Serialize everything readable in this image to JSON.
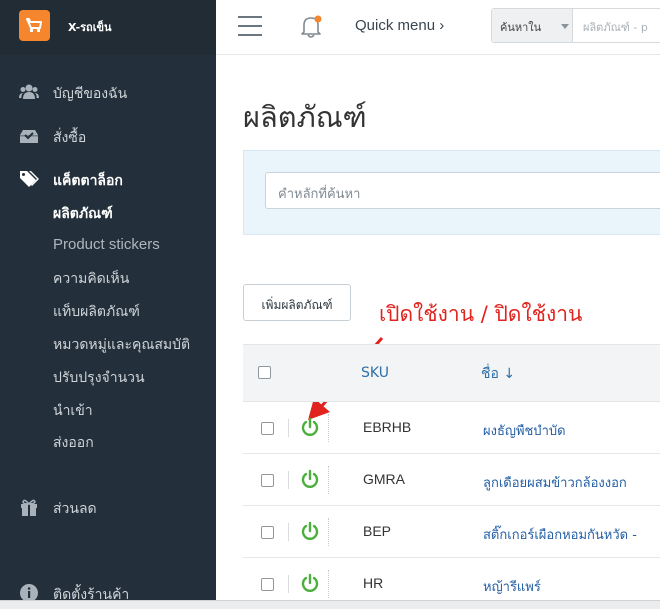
{
  "brand": {
    "name": "X-รถเข็น"
  },
  "sidebar": {
    "items": [
      {
        "label": "บัญชีของฉัน",
        "icon": "users-icon"
      },
      {
        "label": "สั่งซื้อ",
        "icon": "inbox-download-icon"
      },
      {
        "label": "แค็ตตาล็อก",
        "icon": "tags-icon"
      },
      {
        "label": "ส่วนลด",
        "icon": "gift-icon"
      },
      {
        "label": "ติดตั้งร้านค้า",
        "icon": "info-icon"
      }
    ],
    "catalog_sub": [
      "ผลิตภัณฑ์",
      "Product stickers",
      "ความคิดเห็น",
      "แท็บผลิตภัณฑ์",
      "หมวดหมู่และคุณสมบัติ",
      "ปรับปรุงจำนวน",
      "นำเข้า",
      "ส่งออก"
    ]
  },
  "topbar": {
    "quick_menu": "Quick menu ›",
    "search_scope": "ค้นหาใน",
    "search_placeholder": "ผลิตภัณฑ์ - p"
  },
  "main": {
    "title": "ผลิตภัณฑ์",
    "keyword_placeholder": "คำหลักที่ค้นหา",
    "add_button": "เพิ่มผลิตภัณฑ์",
    "annotation": "เปิดใช้งาน  / ปิดใช้งาน"
  },
  "table": {
    "columns": {
      "sku": "SKU",
      "name": "ชื่อ ↓"
    },
    "rows": [
      {
        "sku": "EBRHB",
        "name": "ผงธัญพืชบำบัด"
      },
      {
        "sku": "GMRA",
        "name": "ลูกเดือยผสมข้าวกล้องงอก"
      },
      {
        "sku": "BEP",
        "name": "สติ๊กเกอร์เผือกหอมกันหวัด -"
      },
      {
        "sku": "HR",
        "name": "หญ้ารีแพร์"
      }
    ]
  },
  "colors": {
    "sidebar_bg": "#232f3a",
    "accent_orange": "#f5862e",
    "power_green": "#4caf3c",
    "link_blue": "#245fa5",
    "annotation_red": "#e0231e"
  }
}
